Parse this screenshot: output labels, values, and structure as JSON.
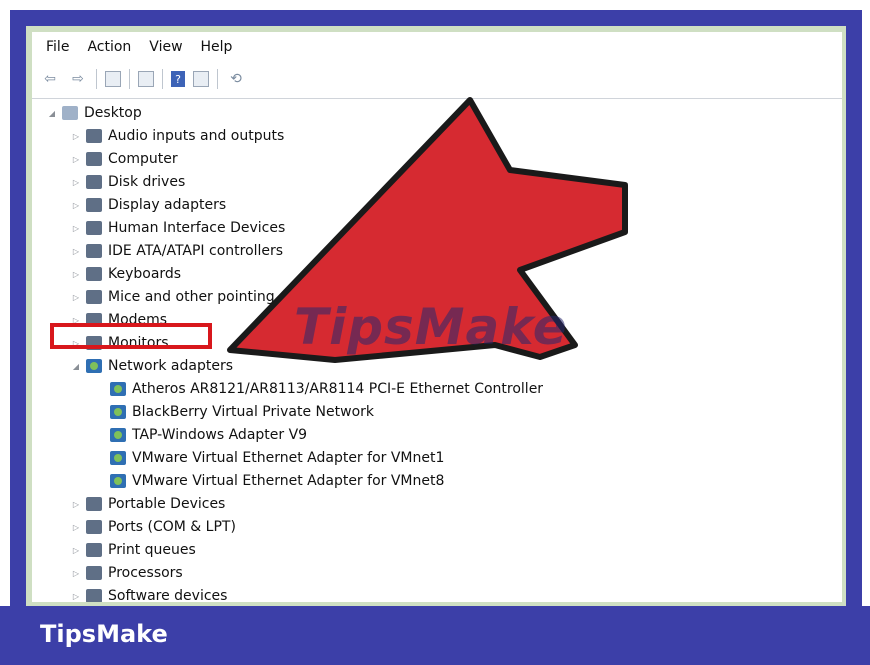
{
  "menu": {
    "file": "File",
    "action": "Action",
    "view": "View",
    "help": "Help"
  },
  "tree": {
    "root": "Desktop",
    "items": [
      "Audio inputs and outputs",
      "Computer",
      "Disk drives",
      "Display adapters",
      "Human Interface Devices",
      "IDE ATA/ATAPI controllers",
      "Keyboards",
      "Mice and other pointing de",
      "Modems",
      "Monitors",
      "Network adapters"
    ],
    "network_children": [
      "Atheros AR8121/AR8113/AR8114 PCI-E Ethernet Controller",
      "BlackBerry Virtual Private Network",
      "TAP-Windows Adapter V9",
      "VMware Virtual Ethernet Adapter for VMnet1",
      "VMware Virtual Ethernet Adapter for VMnet8"
    ],
    "after_items": [
      "Portable Devices",
      "Ports (COM & LPT)",
      "Print queues",
      "Processors",
      "Software devices"
    ]
  },
  "watermark": "TipsMake",
  "brand": "TipsMake",
  "colors": {
    "frame_blue": "#3c3fa8",
    "highlight_red": "#d8171c",
    "arrow_red": "#d62a31"
  }
}
